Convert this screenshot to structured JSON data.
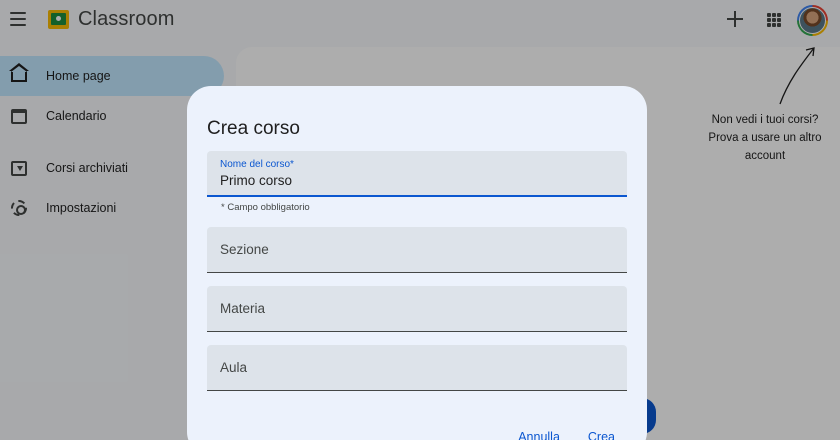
{
  "header": {
    "app_title": "Classroom",
    "icons": [
      "menu-icon",
      "classroom-logo-icon",
      "plus-icon",
      "apps-grid-icon",
      "avatar"
    ]
  },
  "sidebar": {
    "items": [
      {
        "label": "Home page",
        "icon": "home-icon",
        "active": true
      },
      {
        "label": "Calendario",
        "icon": "calendar-icon",
        "active": false
      },
      {
        "label": "Corsi archiviati",
        "icon": "archive-icon",
        "active": false
      },
      {
        "label": "Impostazioni",
        "icon": "gear-icon",
        "active": false
      }
    ]
  },
  "main": {
    "hint_lines": [
      "Non vedi i tuoi corsi?",
      "Prova a usare un altro",
      "account"
    ]
  },
  "dialog": {
    "title": "Crea corso",
    "course_name": {
      "label": "Nome del corso*",
      "value": "Primo corso",
      "helper": "* Campo obbligatorio"
    },
    "section": {
      "placeholder": "Sezione"
    },
    "subject": {
      "placeholder": "Materia"
    },
    "room": {
      "placeholder": "Aula"
    },
    "cancel_label": "Annulla",
    "create_label": "Crea"
  },
  "colors": {
    "accent": "#0b57d0",
    "nav_active": "#c2e7ff",
    "dialog_bg": "#ecf2fc",
    "field_bg": "#dde3ea"
  }
}
